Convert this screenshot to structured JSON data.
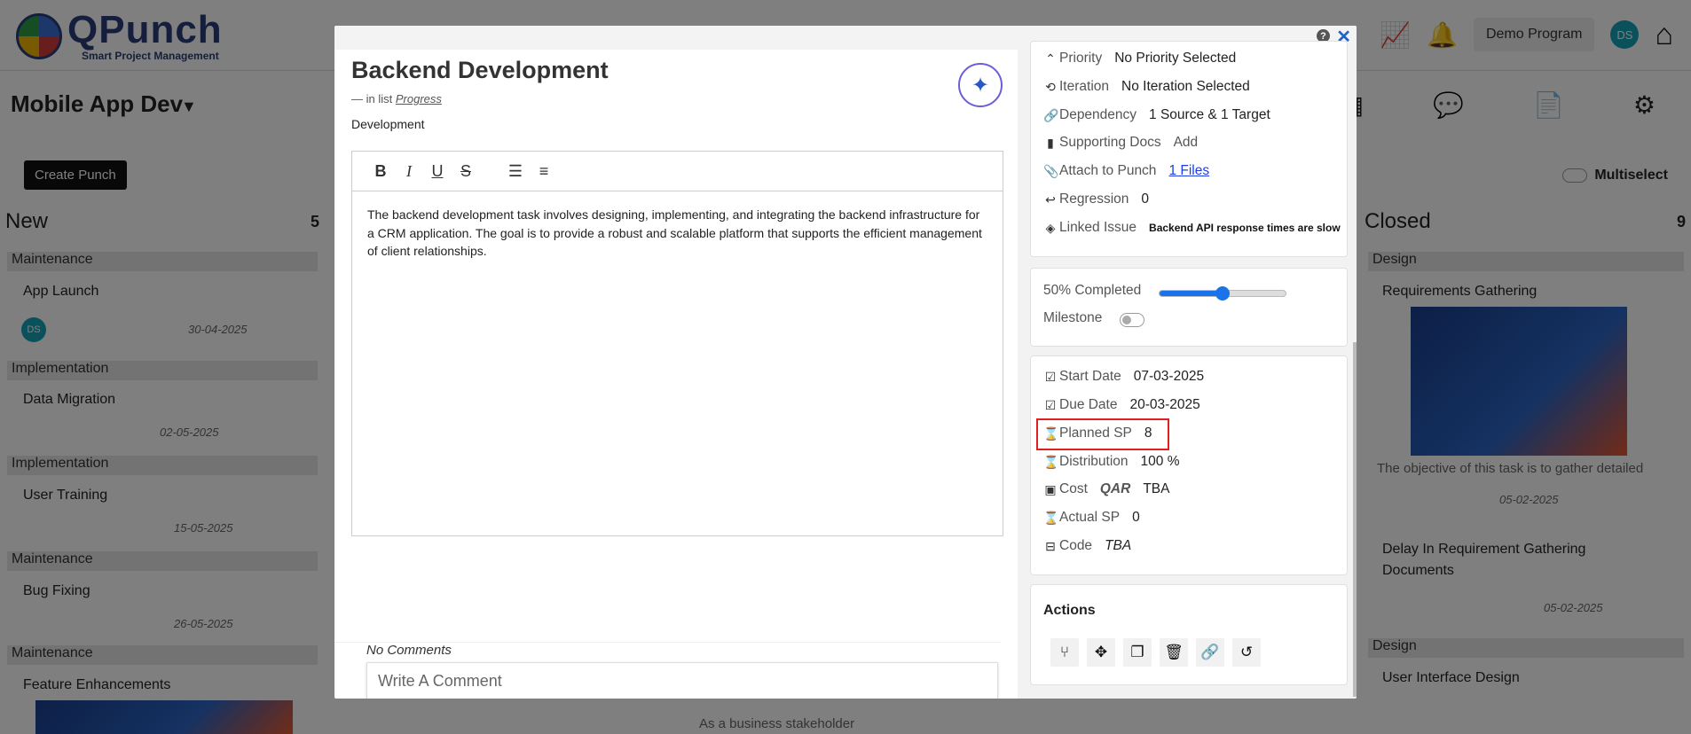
{
  "app": {
    "logo_title": "QPunch",
    "logo_subtitle": "Smart Project Management",
    "program_button": "Demo Program",
    "user_initials": "DS",
    "project_name": "Mobile App Dev",
    "create_punch": "Create Punch",
    "multiselect": "Multiselect"
  },
  "board": {
    "columns": [
      {
        "name": "New",
        "count": "5"
      },
      {
        "name": "Closed",
        "count": "9"
      }
    ],
    "new_lanes": [
      {
        "lane": "Maintenance",
        "title": "App Launch",
        "date": "30-04-2025"
      },
      {
        "lane": "Implementation",
        "title": "Data Migration",
        "date": "02-05-2025"
      },
      {
        "lane": "Implementation",
        "title": "User Training",
        "date": "15-05-2025"
      },
      {
        "lane": "Maintenance",
        "title": "Bug Fixing",
        "date": "26-05-2025"
      },
      {
        "lane": "Maintenance",
        "title": "Feature Enhancements",
        "date": ""
      }
    ],
    "closed_cards": [
      {
        "lane": "Design",
        "title": "Requirements Gathering",
        "snippet": "The objective of this task is to gather detailed",
        "date": "05-02-2025"
      },
      {
        "lane": "",
        "title": "Delay In Requirement Gathering Documents",
        "date": "05-02-2025"
      },
      {
        "lane": "Design",
        "title": "User Interface Design"
      }
    ],
    "middle_snippet": "As a business stakeholder"
  },
  "modal": {
    "title": "Backend Development",
    "in_list_prefix": "— in list",
    "list_name": "Progress",
    "category": "Development",
    "description": "The backend development task involves designing, implementing, and integrating the backend infrastructure for a CRM application. The goal is to provide a robust and scalable platform that supports the efficient management of client relationships.",
    "no_comments": "No Comments",
    "comment_placeholder": "Write A Comment",
    "toolbar": [
      "B",
      "I",
      "U",
      "S",
      "ordered-list",
      "bullet-list"
    ],
    "properties": {
      "priority": {
        "label": "Priority",
        "value": "No Priority Selected"
      },
      "iteration": {
        "label": "Iteration",
        "value": "No Iteration Selected"
      },
      "dependency": {
        "label": "Dependency",
        "value": "1 Source & 1 Target"
      },
      "supporting_docs": {
        "label": "Supporting Docs",
        "value": "Add"
      },
      "attach": {
        "label": "Attach to Punch",
        "value": "1 Files"
      },
      "regression": {
        "label": "Regression",
        "value": "0"
      },
      "linked_issue": {
        "label": "Linked Issue",
        "value": "Backend API response times are slow"
      }
    },
    "progress": {
      "label": "50% Completed",
      "value": 0.5,
      "milestone_label": "Milestone",
      "milestone_on": false
    },
    "dates": {
      "start": {
        "label": "Start Date",
        "value": "07-03-2025"
      },
      "due": {
        "label": "Due Date",
        "value": "20-03-2025"
      },
      "planned_sp": {
        "label": "Planned SP",
        "value": "8"
      },
      "distribution": {
        "label": "Distribution",
        "value": "100 %"
      },
      "cost": {
        "label": "Cost",
        "currency": "QAR",
        "value": "TBA"
      },
      "actual_sp": {
        "label": "Actual SP",
        "value": "0"
      },
      "code": {
        "label": "Code",
        "value": "TBA"
      }
    },
    "actions_title": "Actions",
    "colors": {
      "accent": "#1a73e8",
      "highlight": "#e02020",
      "link": "#1f3de6"
    }
  }
}
